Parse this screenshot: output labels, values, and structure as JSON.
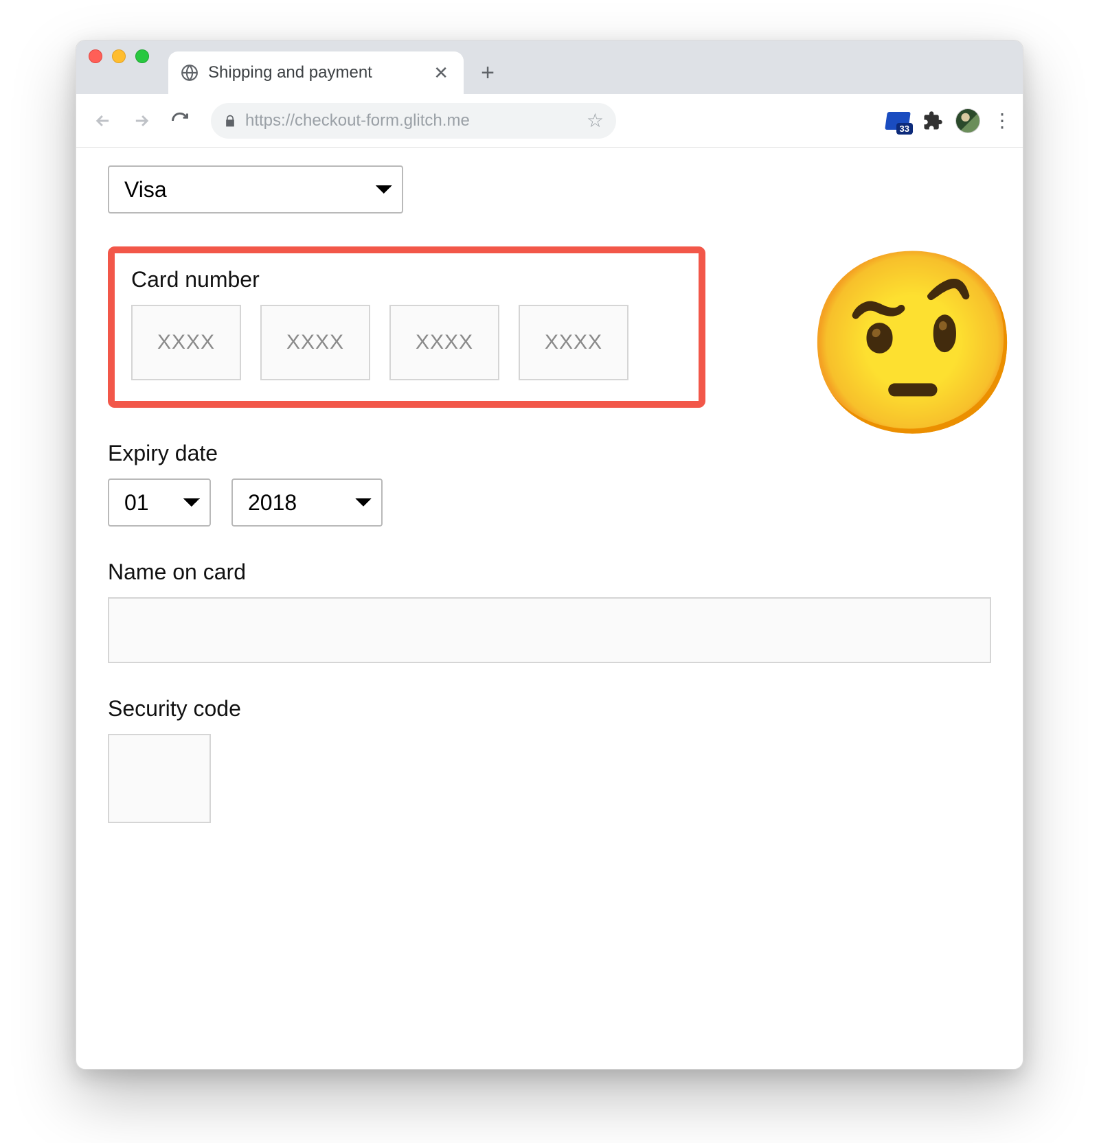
{
  "browser": {
    "tab_title": "Shipping and payment",
    "url": "https://checkout-form.glitch.me",
    "ext_badge": "33"
  },
  "form": {
    "card_type": {
      "selected": "Visa"
    },
    "card_number": {
      "label": "Card number",
      "placeholder": "XXXX"
    },
    "expiry": {
      "label": "Expiry date",
      "month": "01",
      "year": "2018"
    },
    "name_on_card": {
      "label": "Name on card",
      "value": ""
    },
    "security_code": {
      "label": "Security code",
      "value": ""
    }
  },
  "annotation": {
    "emoji": "🤨"
  }
}
